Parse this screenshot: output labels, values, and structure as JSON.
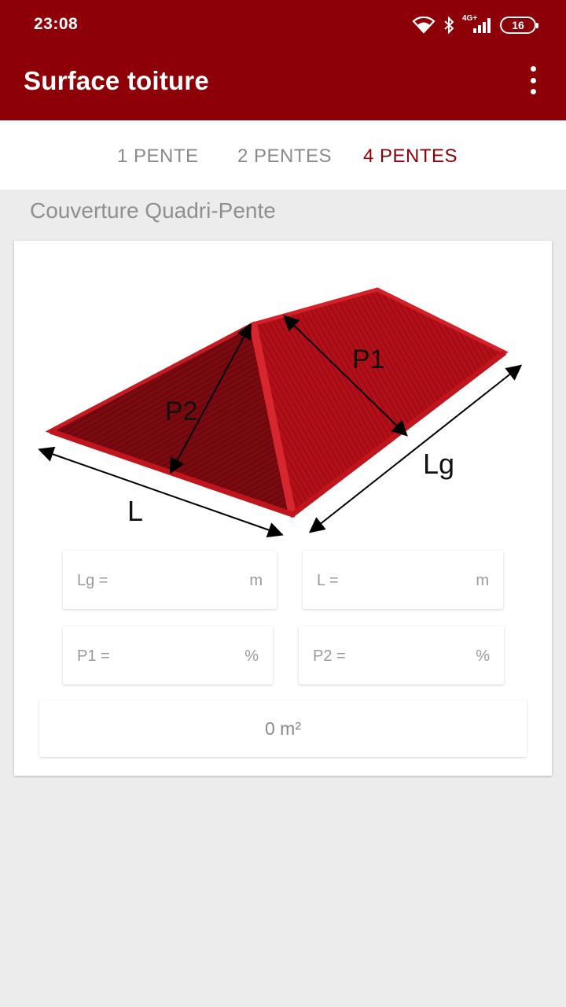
{
  "status_bar": {
    "time": "23:08",
    "network": "4G+",
    "battery": "16"
  },
  "app_bar": {
    "title": "Surface toiture",
    "menu_icon": "more-vert-icon"
  },
  "tabs": [
    {
      "label": "1 PENTE",
      "selected": false
    },
    {
      "label": "2 PENTES",
      "selected": false
    },
    {
      "label": "4 PENTES",
      "selected": true
    }
  ],
  "section": {
    "title": "Couverture Quadri-Pente"
  },
  "diagram": {
    "labels": {
      "P1": "P1",
      "P2": "P2",
      "Lg": "Lg",
      "L": "L"
    },
    "roof_color": "#b5101a"
  },
  "inputs": {
    "lg": {
      "label": "Lg =",
      "unit": "m",
      "value": ""
    },
    "l": {
      "label": "L =",
      "unit": "m",
      "value": ""
    },
    "p1": {
      "label": "P1 =",
      "unit": "%",
      "value": ""
    },
    "p2": {
      "label": "P2 =",
      "unit": "%",
      "value": ""
    }
  },
  "result": "0 m²",
  "colors": {
    "primary": "#8e0008",
    "tab_inactive": "#8a8a8a",
    "background": "#ececec"
  }
}
